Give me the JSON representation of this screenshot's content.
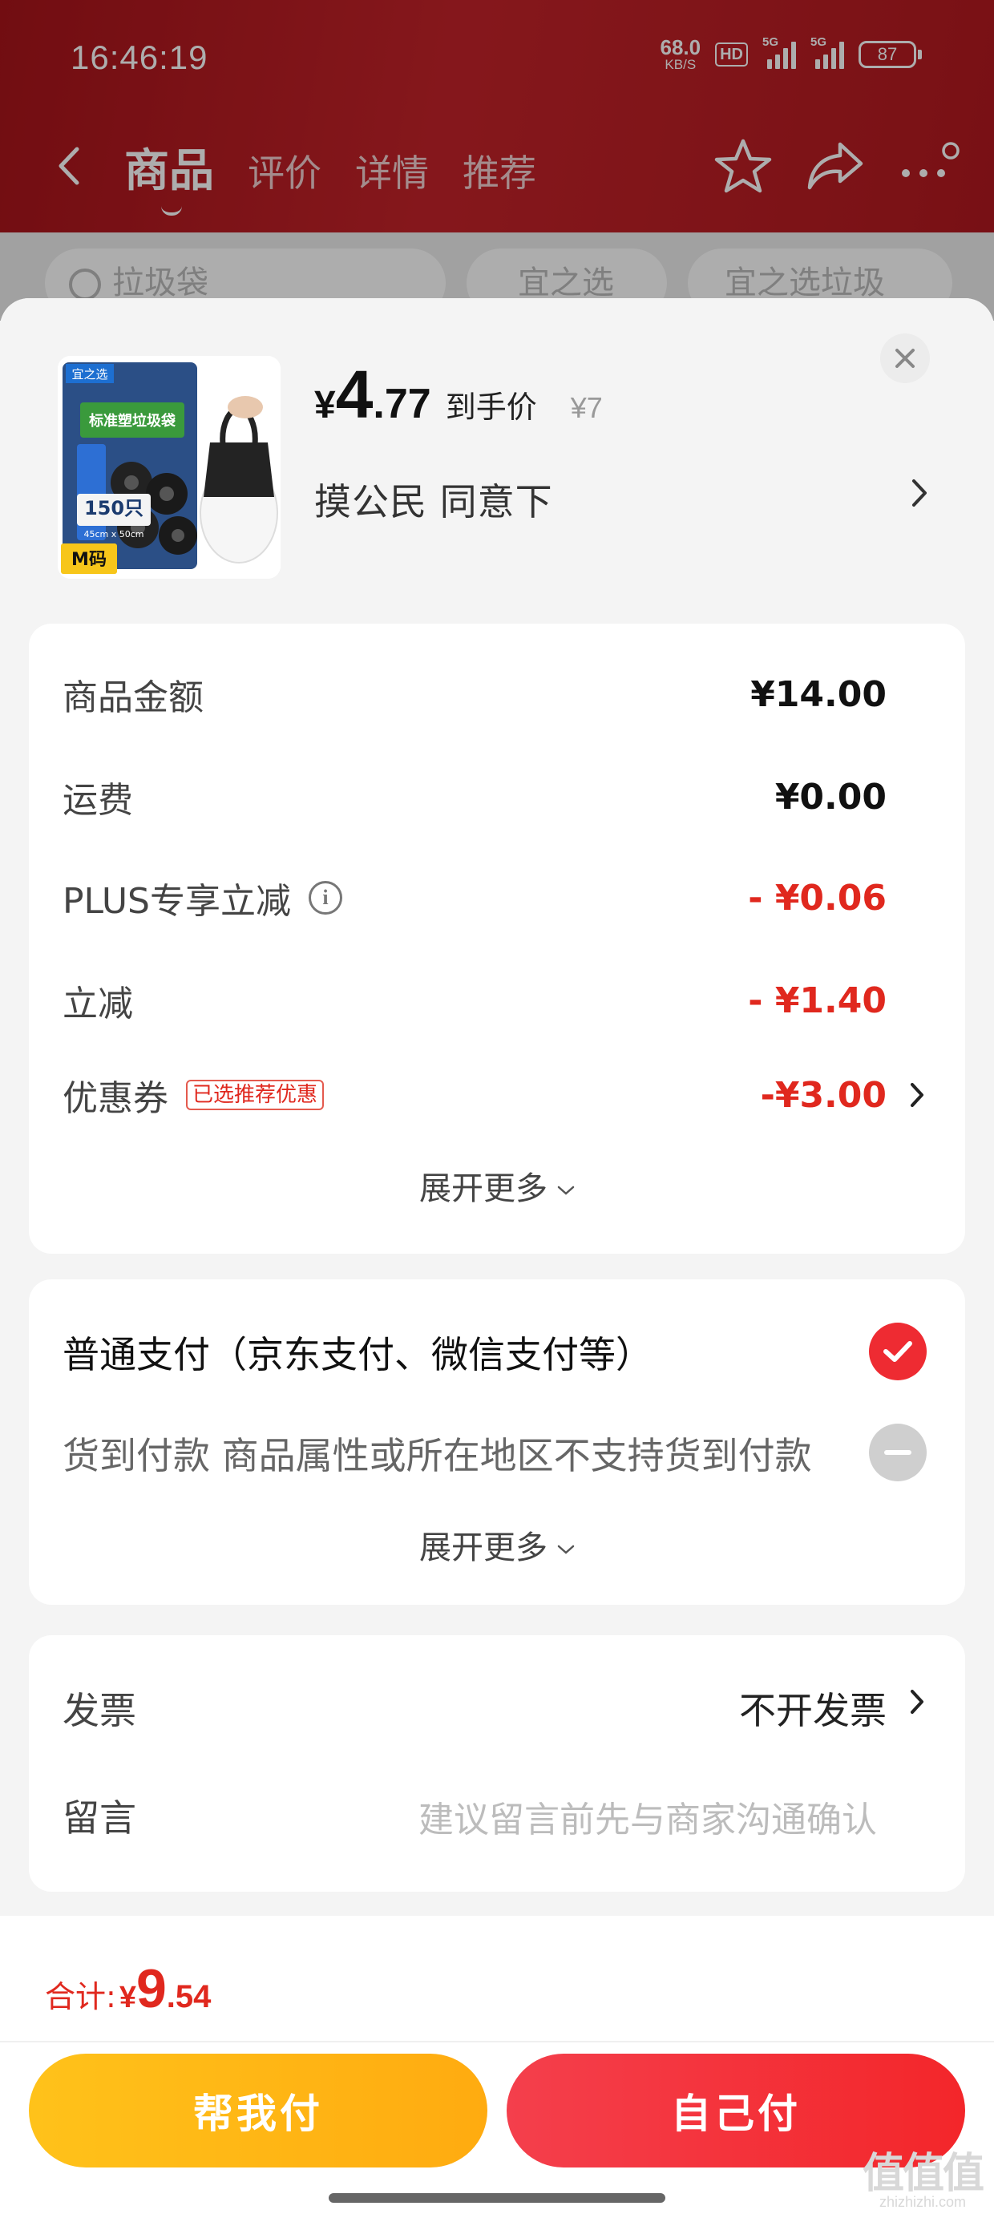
{
  "status_bar": {
    "time": "16:46:19",
    "net_speed_value": "68.0",
    "net_speed_unit": "KB/S",
    "hd_label": "HD",
    "signal_1": "5G",
    "signal_2": "5G",
    "battery": "87"
  },
  "nav": {
    "tabs": [
      {
        "label": "商品",
        "active": true
      },
      {
        "label": "评价"
      },
      {
        "label": "详情"
      },
      {
        "label": "推荐"
      }
    ],
    "icons": [
      "back-icon",
      "star-icon",
      "share-icon",
      "more-icon"
    ]
  },
  "background_row": {
    "search_text": "拉圾袋",
    "chip_1": "宜之选",
    "chip_2": "宜之选垃圾"
  },
  "product": {
    "thumb_brand": "宜之选",
    "thumb_title": "标准塑垃圾袋",
    "thumb_count": "150只",
    "thumb_size": "45cm x 50cm",
    "thumb_tag": "M码",
    "price_yen": "¥",
    "price_int": "4",
    "price_dec": ".77",
    "price_label": "到手价",
    "original_price": "¥7",
    "spec": "摸公民  同意下"
  },
  "amounts": {
    "rows": [
      {
        "label": "商品金额",
        "value": "¥14.00"
      },
      {
        "label": "运费",
        "value": "¥0.00"
      },
      {
        "label": "PLUS专享立减",
        "value": "- ¥0.06"
      },
      {
        "label": "立减",
        "value": "- ¥1.40"
      },
      {
        "label": "优惠券",
        "tag": "已选推荐优惠",
        "value": "-¥3.00"
      }
    ],
    "expand": "展开更多"
  },
  "payment": {
    "normal": "普通支付（京东支付、微信支付等）",
    "cod": "货到付款 商品属性或所在地区不支持货到付款",
    "expand": "展开更多"
  },
  "invoice": {
    "label": "发票",
    "value": "不开发票",
    "note_label": "留言",
    "note_placeholder": "建议留言前先与商家沟通确认"
  },
  "footer": {
    "total_label": "合计:",
    "total_yen": "¥",
    "total_int": "9",
    "total_dec": ".54",
    "help_pay": "帮我付",
    "self_pay": "自己付"
  },
  "watermark": {
    "big": "值值值",
    "small": "zhizhizhi.com"
  },
  "colors": {
    "brand_red": "#e0281e",
    "header_red": "#b2191f",
    "help_button": "#ffb612",
    "self_button": "#f3262a"
  }
}
